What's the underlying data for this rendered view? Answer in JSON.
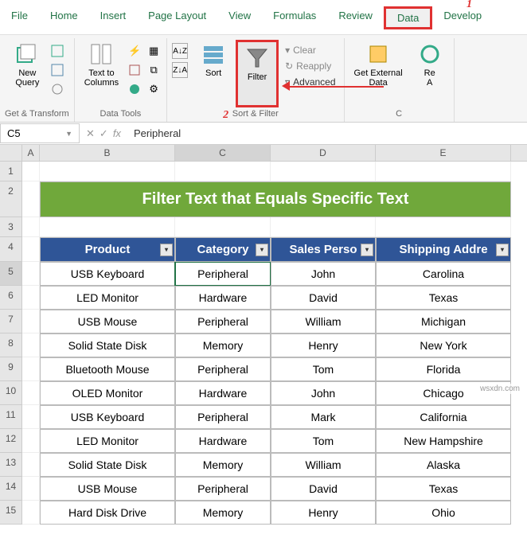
{
  "ribbon": {
    "tabs": [
      "File",
      "Home",
      "Insert",
      "Page Layout",
      "View",
      "Formulas",
      "Review",
      "Data",
      "Develop"
    ],
    "groups": {
      "get_transform": {
        "new_query": "New\nQuery",
        "label": "Get & Transform"
      },
      "data_tools": {
        "text_to_columns": "Text to\nColumns",
        "label": "Data Tools"
      },
      "sort_filter": {
        "sort": "Sort",
        "filter": "Filter",
        "clear": "Clear",
        "reapply": "Reapply",
        "advanced": "Advanced",
        "label": "Sort & Filter"
      },
      "external": {
        "get_external": "Get External\nData",
        "refresh": "Re\nA",
        "label": "C"
      }
    }
  },
  "annotations": {
    "one": "1",
    "two": "2"
  },
  "formula": {
    "namebox": "C5",
    "value": "Peripheral"
  },
  "columns": [
    "A",
    "B",
    "C",
    "D",
    "E"
  ],
  "rows": [
    "1",
    "2",
    "3",
    "4",
    "5",
    "6",
    "7",
    "8",
    "9",
    "10",
    "11",
    "12",
    "13",
    "14",
    "15"
  ],
  "banner": "Filter Text that Equals Specific Text",
  "headers": [
    "Product",
    "Category",
    "Sales Perso",
    "Shipping Addre"
  ],
  "chart_data": {
    "type": "table",
    "columns": [
      "Product",
      "Category",
      "Sales Person",
      "Shipping Address"
    ],
    "rows": [
      [
        "USB Keyboard",
        "Peripheral",
        "John",
        "Carolina"
      ],
      [
        "LED Monitor",
        "Hardware",
        "David",
        "Texas"
      ],
      [
        "USB Mouse",
        "Peripheral",
        "William",
        "Michigan"
      ],
      [
        "Solid State Disk",
        "Memory",
        "Henry",
        "New York"
      ],
      [
        "Bluetooth Mouse",
        "Peripheral",
        "Tom",
        "Florida"
      ],
      [
        "OLED Monitor",
        "Hardware",
        "John",
        "Chicago"
      ],
      [
        "USB Keyboard",
        "Peripheral",
        "Mark",
        "California"
      ],
      [
        "LED Monitor",
        "Hardware",
        "Tom",
        "New Hampshire"
      ],
      [
        "Solid State Disk",
        "Memory",
        "William",
        "Alaska"
      ],
      [
        "USB Mouse",
        "Peripheral",
        "David",
        "Texas"
      ],
      [
        "Hard Disk Drive",
        "Memory",
        "Henry",
        "Ohio"
      ]
    ]
  },
  "watermark": "wsxdn.com"
}
